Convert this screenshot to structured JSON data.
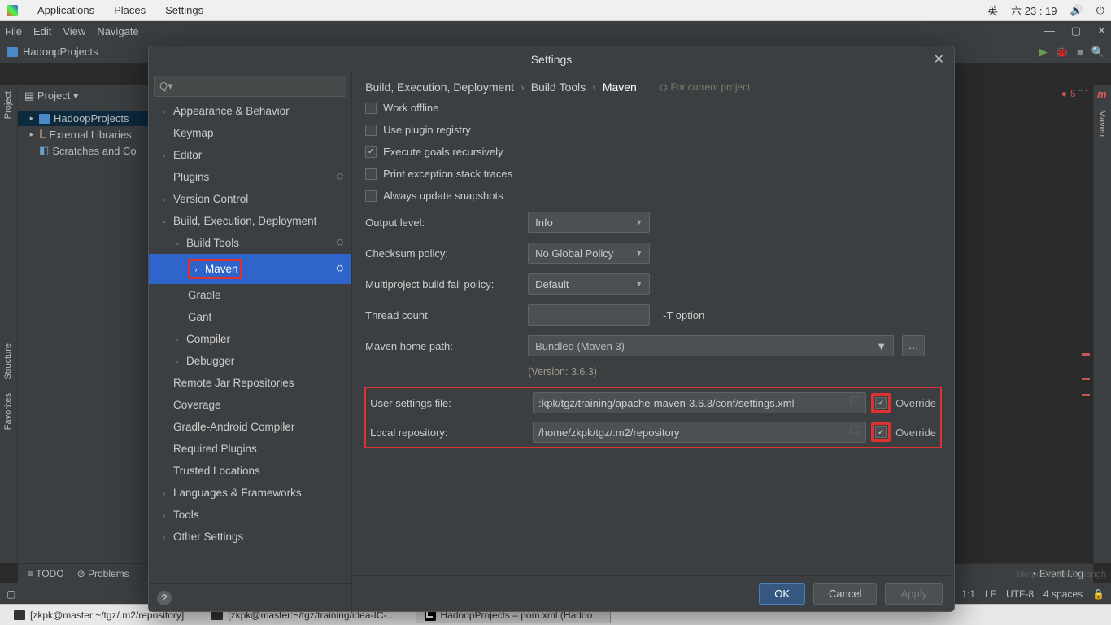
{
  "system_bar": {
    "activities": "Applications",
    "places": "Places",
    "settings": "Settings",
    "lang": "英",
    "date": "六 23 : 19"
  },
  "ide_menu": {
    "file": "File",
    "edit": "Edit",
    "view": "View",
    "navigate": "Navigate"
  },
  "project_name": "HadoopProjects",
  "project_header": "Project",
  "project_tree": {
    "root": "HadoopProjects",
    "ext_libs": "External Libraries",
    "scratches": "Scratches and Co"
  },
  "side_tabs": {
    "project": "Project",
    "structure": "Structure",
    "favorites": "Favorites",
    "maven": "Maven"
  },
  "dialog": {
    "title": "Settings",
    "search_placeholder": "",
    "categories": {
      "appearance": "Appearance & Behavior",
      "keymap": "Keymap",
      "editor": "Editor",
      "plugins": "Plugins",
      "vcs": "Version Control",
      "build": "Build, Execution, Deployment",
      "build_tools": "Build Tools",
      "maven": "Maven",
      "gradle": "Gradle",
      "gant": "Gant",
      "compiler": "Compiler",
      "debugger": "Debugger",
      "remote_jar": "Remote Jar Repositories",
      "coverage": "Coverage",
      "gradle_android": "Gradle-Android Compiler",
      "required_plugins": "Required Plugins",
      "trusted": "Trusted Locations",
      "lang_fw": "Languages & Frameworks",
      "tools": "Tools",
      "other": "Other Settings"
    },
    "breadcrumb": {
      "a": "Build, Execution, Deployment",
      "b": "Build Tools",
      "c": "Maven",
      "note": "For current project"
    },
    "checks": {
      "work_offline": "Work offline",
      "plugin_registry": "Use plugin registry",
      "exec_recursive": "Execute goals recursively",
      "print_exc": "Print exception stack traces",
      "update_snapshots": "Always update snapshots"
    },
    "fields": {
      "output_level": {
        "label": "Output level:",
        "value": "Info"
      },
      "checksum": {
        "label": "Checksum policy:",
        "value": "No Global Policy"
      },
      "multi_fail": {
        "label": "Multiproject build fail policy:",
        "value": "Default"
      },
      "thread_count": {
        "label": "Thread count",
        "value": "",
        "option": "-T option"
      },
      "maven_home": {
        "label": "Maven home path:",
        "value": "Bundled (Maven 3)"
      },
      "version": "(Version: 3.6.3)",
      "user_settings": {
        "label": "User settings file:",
        "value": ":kpk/tgz/training/apache-maven-3.6.3/conf/settings.xml",
        "override": "Override"
      },
      "local_repo": {
        "label": "Local repository:",
        "value": "/home/zkpk/tgz/.m2/repository",
        "override": "Override"
      }
    },
    "buttons": {
      "ok": "OK",
      "cancel": "Cancel",
      "apply": "Apply"
    }
  },
  "bottom_tabs": {
    "todo": "TODO",
    "problems": "Problems"
  },
  "status": {
    "event_log": "Event Log",
    "line_col": "1:1",
    "lf": "LF",
    "enc": "UTF-8",
    "spaces": "4 spaces"
  },
  "error_count": "5",
  "taskbar": {
    "t1": "[zkpk@master:~/tgz/.m2/repository]",
    "t2": "[zkpk@master:~/tgz/training/idea-IC-…",
    "t3": "HadoopProjects – pom.xml (Hadoo…"
  },
  "watermark": "blog.csdn.net/sujiangh"
}
